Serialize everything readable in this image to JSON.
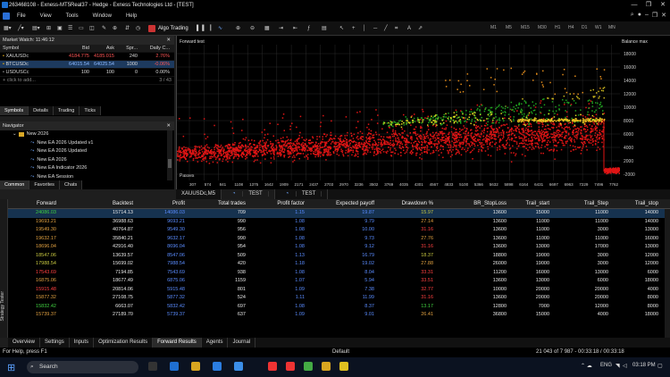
{
  "window": {
    "title": "263468108 - Exness-MT5Real37 - Hedge - Exness Technologies Ltd - [TEST]",
    "controls": [
      "—",
      "❐",
      "✕"
    ]
  },
  "menu": {
    "items": [
      "File",
      "View",
      "Tools",
      "Window",
      "Help"
    ]
  },
  "toolbar": {
    "algo_label": "Algo Trading",
    "timeframes": [
      "M1",
      "M5",
      "M15",
      "M30",
      "H1",
      "H4",
      "D1",
      "W1",
      "MN"
    ]
  },
  "market_watch": {
    "title": "Market Watch: 11:46:12",
    "columns": [
      "Symbol",
      "Bid",
      "Ask",
      "Spr...",
      "Daily C..."
    ],
    "rows": [
      {
        "symbol": "XAUUSDc",
        "bid": "4184.775",
        "ask": "4185.015",
        "spread": "240",
        "daily": "2.76%",
        "bid_color": "#ff5555",
        "ask_color": "#ff5555",
        "daily_color": "#ff5555"
      },
      {
        "symbol": "BTCUSDc",
        "bid": "64015.54",
        "ask": "64025.54",
        "spread": "1000",
        "daily": "-0.06%",
        "bid_color": "#6fa8ff",
        "ask_color": "#6fa8ff",
        "daily_color": "#ff5555"
      },
      {
        "symbol": "USDUSCc",
        "bid": "100",
        "ask": "100",
        "spread": "0",
        "daily": "0.00%",
        "bid_color": "#ddd",
        "ask_color": "#ddd",
        "daily_color": "#ddd"
      }
    ],
    "add_placeholder": "click to add...",
    "count": "3 / 43",
    "tabs": [
      "Symbols",
      "Details",
      "Trading",
      "Ticks"
    ]
  },
  "navigator": {
    "title": "Navigator",
    "items": [
      "New 2026",
      "New EA 2026 Updated v1",
      "New EA 2026 Updated",
      "New EA 2026",
      "New EA Indicator 2026",
      "New EA Session"
    ],
    "tabs": [
      "Common",
      "Favorites",
      "Chats"
    ]
  },
  "chart": {
    "label": "Forward test",
    "balance_label": "Balance max",
    "passes_label": "Passes",
    "y_ticks": [
      "18000",
      "16000",
      "14000",
      "12000",
      "10000",
      "8000",
      "6000",
      "4000",
      "2000",
      "-2000"
    ],
    "x_ticks": [
      "307",
      "574",
      "841",
      "1108",
      "1375",
      "1642",
      "1909",
      "2171",
      "2437",
      "2703",
      "2970",
      "3236",
      "3502",
      "3769",
      "4035",
      "4301",
      "4567",
      "4833",
      "5100",
      "5366",
      "5632",
      "5898",
      "6164",
      "6431",
      "6697",
      "6963",
      "7229",
      "7496",
      "7762"
    ],
    "tabs": [
      "XAUUSDc,M5",
      "TEST",
      "TEST"
    ]
  },
  "results": {
    "side_label": "Strategy Tester",
    "columns": [
      "Forward",
      "Backtest",
      "Profit",
      "Total trades",
      "Profit factor",
      "Expected payoff",
      "Drawdown %",
      "BR_StopLoss",
      "Trail_start",
      "Trail_Step",
      "Trail_stop"
    ],
    "rows": [
      {
        "forward": "24086.03",
        "backtest": "15714.13",
        "profit": "14086.03",
        "trades": "709",
        "pf": "1.15",
        "payoff": "19.87",
        "dd": "15.97",
        "sl": "13600",
        "ts": "15000",
        "step": "11000",
        "stop": "14000",
        "fc": "#40d040",
        "dc": "#c8c840"
      },
      {
        "forward": "19693.21",
        "backtest": "36988.63",
        "profit": "9693.21",
        "trades": "990",
        "pf": "1.08",
        "payoff": "9.79",
        "dd": "27.14",
        "sl": "13600",
        "ts": "11000",
        "step": "11000",
        "stop": "14000",
        "fc": "#e0a040",
        "dc": "#e0a040"
      },
      {
        "forward": "19549.30",
        "backtest": "40764.87",
        "profit": "9549.30",
        "trades": "956",
        "pf": "1.08",
        "payoff": "10.00",
        "dd": "31.16",
        "sl": "13600",
        "ts": "11000",
        "step": "3000",
        "stop": "13000",
        "fc": "#e0a040",
        "dc": "#ff4040"
      },
      {
        "forward": "19632.17",
        "backtest": "35840.21",
        "profit": "9632.17",
        "trades": "990",
        "pf": "1.08",
        "payoff": "9.73",
        "dd": "27.76",
        "sl": "13600",
        "ts": "11000",
        "step": "11000",
        "stop": "16000",
        "fc": "#e0a040",
        "dc": "#e0a040"
      },
      {
        "forward": "18696.04",
        "backtest": "42916.40",
        "profit": "8696.04",
        "trades": "954",
        "pf": "1.08",
        "payoff": "9.12",
        "dd": "31.16",
        "sl": "13600",
        "ts": "13000",
        "step": "17000",
        "stop": "13000",
        "fc": "#e0a040",
        "dc": "#ff4040"
      },
      {
        "forward": "18547.06",
        "backtest": "13639.57",
        "profit": "8547.06",
        "trades": "509",
        "pf": "1.13",
        "payoff": "16.79",
        "dd": "18.37",
        "sl": "18800",
        "ts": "19000",
        "step": "3000",
        "stop": "12000",
        "fc": "#c8c840",
        "dc": "#c8c840"
      },
      {
        "forward": "17988.54",
        "backtest": "15699.02",
        "profit": "7988.54",
        "trades": "420",
        "pf": "1.18",
        "payoff": "19.02",
        "dd": "27.88",
        "sl": "26000",
        "ts": "19000",
        "step": "3000",
        "stop": "12000",
        "fc": "#c8c840",
        "dc": "#e0a040"
      },
      {
        "forward": "17543.69",
        "backtest": "7194.85",
        "profit": "7543.69",
        "trades": "938",
        "pf": "1.08",
        "payoff": "8.04",
        "dd": "33.31",
        "sl": "11200",
        "ts": "16000",
        "step": "13000",
        "stop": "6000",
        "fc": "#ff4040",
        "dc": "#ff4040"
      },
      {
        "forward": "16875.06",
        "backtest": "18677.49",
        "profit": "6875.06",
        "trades": "1159",
        "pf": "1.07",
        "payoff": "5.94",
        "dd": "33.51",
        "sl": "13600",
        "ts": "13000",
        "step": "6000",
        "stop": "18000",
        "fc": "#e0a040",
        "dc": "#ff4040"
      },
      {
        "forward": "15915.48",
        "backtest": "20814.06",
        "profit": "5915.48",
        "trades": "801",
        "pf": "1.09",
        "payoff": "7.38",
        "dd": "32.77",
        "sl": "10000",
        "ts": "20000",
        "step": "20000",
        "stop": "4000",
        "fc": "#ff4040",
        "dc": "#ff4040"
      },
      {
        "forward": "15877.32",
        "backtest": "27108.75",
        "profit": "5877.32",
        "trades": "524",
        "pf": "1.11",
        "payoff": "11.99",
        "dd": "31.16",
        "sl": "13600",
        "ts": "20000",
        "step": "20000",
        "stop": "8000",
        "fc": "#e0a040",
        "dc": "#ff4040"
      },
      {
        "forward": "15832.42",
        "backtest": "6663.07",
        "profit": "5832.42",
        "trades": "697",
        "pf": "1.08",
        "payoff": "8.37",
        "dd": "13.17",
        "sl": "12800",
        "ts": "7000",
        "step": "12000",
        "stop": "8000",
        "fc": "#40d040",
        "dc": "#40d040"
      },
      {
        "forward": "15739.37",
        "backtest": "27189.70",
        "profit": "5739.37",
        "trades": "637",
        "pf": "1.09",
        "payoff": "9.01",
        "dd": "26.41",
        "sl": "36800",
        "ts": "15000",
        "step": "4000",
        "stop": "18000",
        "fc": "#e0a040",
        "dc": "#e0a040"
      }
    ]
  },
  "bottom_tabs": [
    "Overview",
    "Settings",
    "Inputs",
    "Optimization Results",
    "Forward Results",
    "Agents",
    "Journal"
  ],
  "status": {
    "help": "For Help, press F1",
    "profile": "Default",
    "progress": "21 043 of 7 987 - 00:33:18 / 00:33:18"
  },
  "taskbar": {
    "search": "Search",
    "lang": "ENG",
    "time": "03:18 PM"
  }
}
